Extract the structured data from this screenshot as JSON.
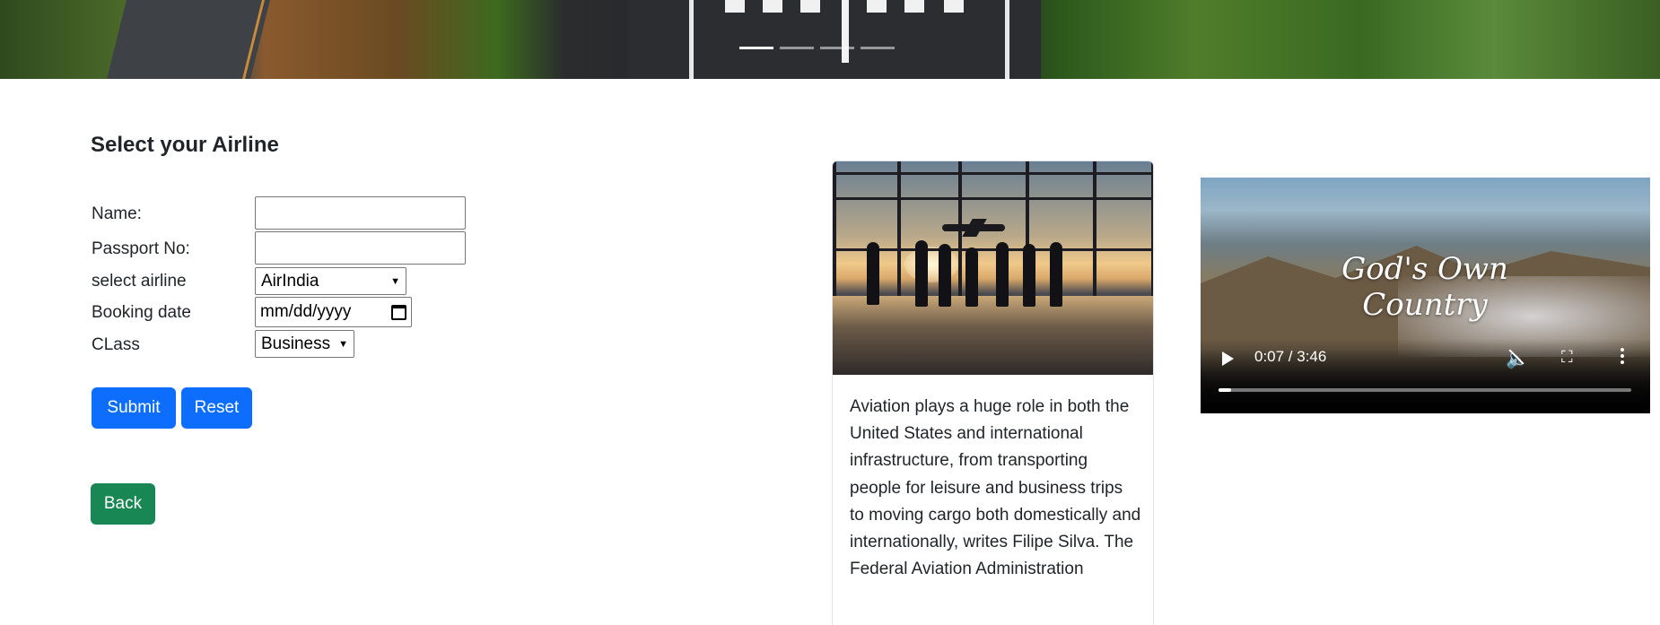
{
  "form": {
    "title": "Select your Airline",
    "name_label": "Name:",
    "name_value": "",
    "passport_label": "Passport No:",
    "passport_value": "",
    "airline_label": "select airline",
    "airline_selected": "AirIndia",
    "date_label": "Booking date",
    "date_placeholder": "mm/dd/yyyy",
    "class_label": "CLass",
    "class_selected": "Business",
    "submit_label": "Submit",
    "reset_label": "Reset",
    "back_label": "Back"
  },
  "carousel": {
    "active_index": 0,
    "indicator_count": 4
  },
  "card": {
    "text": "Aviation plays a huge role in both the United States and international infrastructure, from transporting people for leisure and business trips to moving cargo both domestically and internationally, writes Filipe Silva. The Federal Aviation Administration"
  },
  "video": {
    "overlay_title": "God's Own Country",
    "time_display": "0:07 / 3:46",
    "progress_fraction": 0.031,
    "icons": {
      "play": "play-icon",
      "mute": "volume-muted-icon",
      "fullscreen": "fullscreen-icon",
      "more": "more-options-icon"
    }
  },
  "colors": {
    "primary": "#0d6efd",
    "success": "#198754",
    "text": "#212529"
  }
}
